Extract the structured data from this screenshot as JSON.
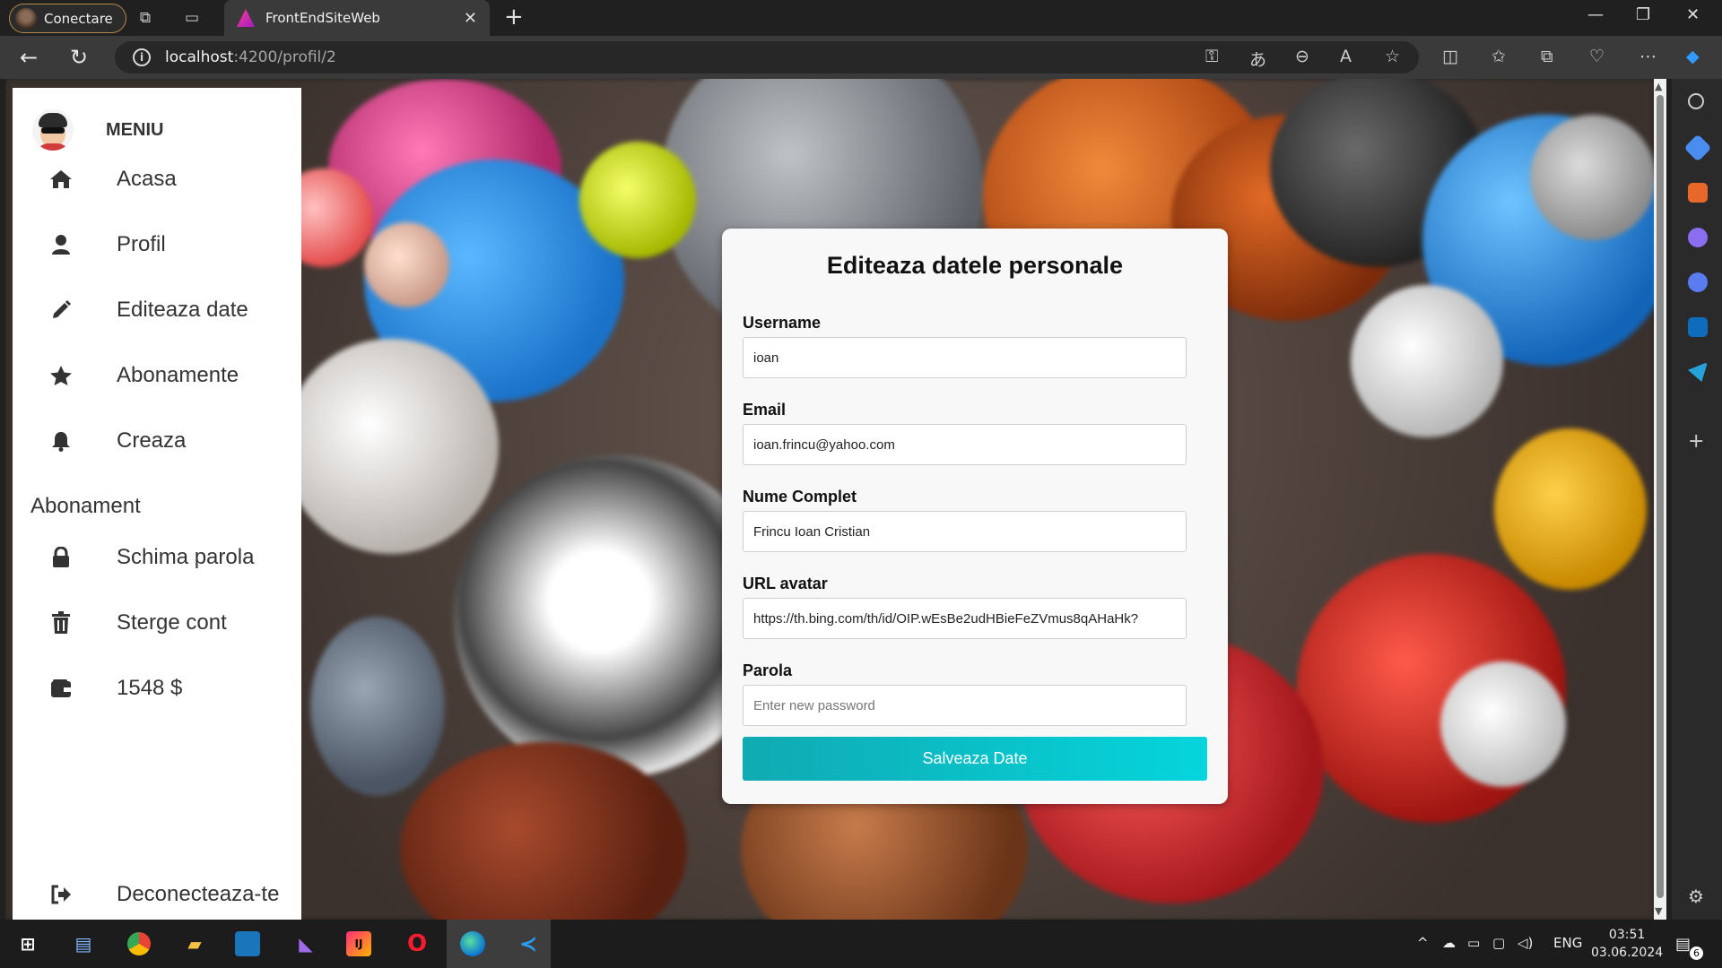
{
  "browser": {
    "profile_label": "Conectare",
    "tab_title": "FrontEndSiteWeb",
    "url_host": "localhost",
    "url_path": ":4200/profil/2"
  },
  "sidebar": {
    "title": "MENIU",
    "items": [
      {
        "label": "Acasa",
        "icon": "home-icon"
      },
      {
        "label": "Profil",
        "icon": "user-icon"
      },
      {
        "label": "Editeaza date",
        "icon": "pencil-icon"
      },
      {
        "label": "Abonamente",
        "icon": "star-icon"
      },
      {
        "label": "Creaza",
        "icon": "bell-icon"
      },
      {
        "label": "Abonament",
        "icon": ""
      },
      {
        "label": "Schima parola",
        "icon": "lock-icon"
      },
      {
        "label": "Sterge cont",
        "icon": "trash-icon"
      },
      {
        "label": "1548 $",
        "icon": "wallet-icon"
      }
    ],
    "logout_label": "Deconecteaza-te"
  },
  "form": {
    "title": "Editeaza datele personale",
    "fields": [
      {
        "label": "Username",
        "value": "ioan",
        "placeholder": ""
      },
      {
        "label": "Email",
        "value": "ioan.frincu@yahoo.com",
        "placeholder": ""
      },
      {
        "label": "Nume Complet",
        "value": "Frincu Ioan Cristian",
        "placeholder": ""
      },
      {
        "label": "URL avatar",
        "value": "https://th.bing.com/th/id/OIP.wEsBe2udHBieFeZVmus8qAHaHk?",
        "placeholder": ""
      },
      {
        "label": "Parola",
        "value": "",
        "placeholder": "Enter new password"
      }
    ],
    "save_label": "Salveaza Date"
  },
  "taskbar": {
    "language": "ENG",
    "time": "03:51",
    "date": "03.06.2024",
    "notification_count": "6"
  },
  "colors": {
    "accent_start": "#10aab2",
    "accent_end": "#05d5dc",
    "menu_text": "#333333"
  }
}
